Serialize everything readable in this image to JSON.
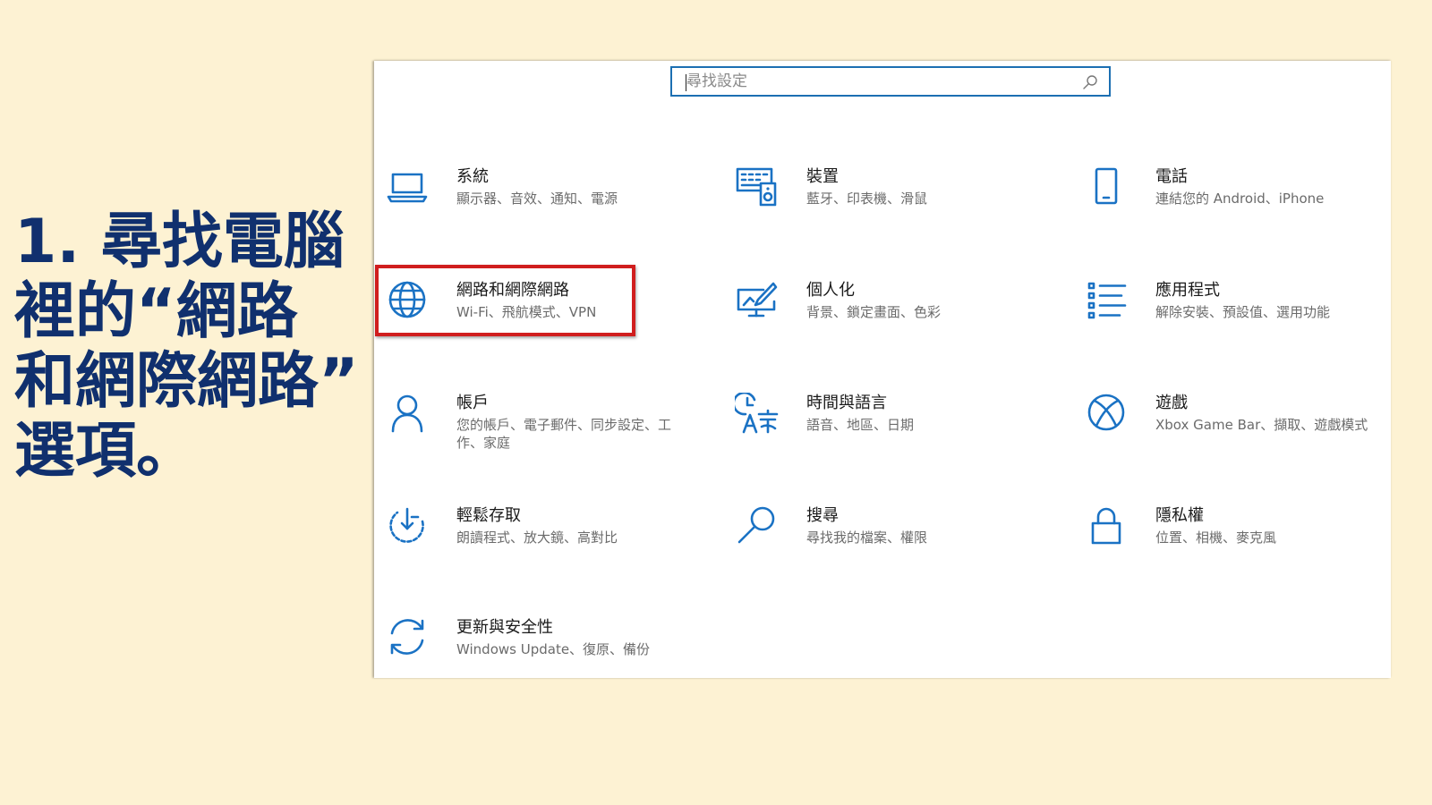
{
  "instruction": {
    "lines": [
      "1. 尋找電腦",
      "裡的“網路",
      "和網際網路”",
      "選項。"
    ]
  },
  "search": {
    "placeholder": "尋找設定"
  },
  "tiles": [
    {
      "title": "系統",
      "desc": "顯示器、音效、通知、電源",
      "icon": "laptop-icon"
    },
    {
      "title": "裝置",
      "desc": "藍牙、印表機、滑鼠",
      "icon": "devices-icon"
    },
    {
      "title": "電話",
      "desc": "連結您的 Android、iPhone",
      "icon": "phone-icon"
    },
    {
      "title": "網路和網際網路",
      "desc": "Wi-Fi、飛航模式、VPN",
      "icon": "globe-icon"
    },
    {
      "title": "個人化",
      "desc": "背景、鎖定畫面、色彩",
      "icon": "personalization-icon"
    },
    {
      "title": "應用程式",
      "desc": "解除安裝、預設值、選用功能",
      "icon": "apps-list-icon"
    },
    {
      "title": "帳戶",
      "desc": "您的帳戶、電子郵件、同步設定、工作、家庭",
      "icon": "person-icon"
    },
    {
      "title": "時間與語言",
      "desc": "語音、地區、日期",
      "icon": "time-language-icon"
    },
    {
      "title": "遊戲",
      "desc": "Xbox Game Bar、擷取、遊戲模式",
      "icon": "xbox-icon"
    },
    {
      "title": "輕鬆存取",
      "desc": "朗讀程式、放大鏡、高對比",
      "icon": "ease-of-access-icon"
    },
    {
      "title": "搜尋",
      "desc": "尋找我的檔案、權限",
      "icon": "search-magnifier-icon"
    },
    {
      "title": "隱私權",
      "desc": "位置、相機、麥克風",
      "icon": "lock-icon"
    },
    {
      "title": "更新與安全性",
      "desc": "Windows Update、復原、備份",
      "icon": "update-sync-icon"
    }
  ],
  "colors": {
    "accent": "#1a72c4",
    "highlight": "#d01e1e",
    "instruction_text": "#10306e",
    "background": "#fdf2d3"
  }
}
